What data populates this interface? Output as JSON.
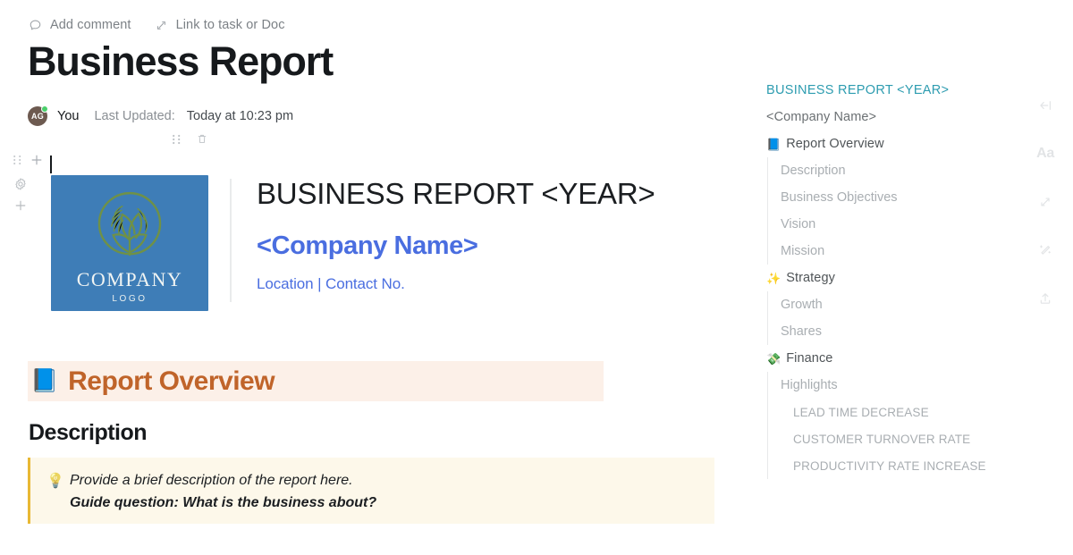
{
  "topbar": {
    "add_comment": "Add comment",
    "link_to_task": "Link to task or Doc",
    "comment_icon": "comment-bubble-icon",
    "link_icon": "link-arrow-icon"
  },
  "document": {
    "title": "Business Report",
    "author_initials": "AG",
    "author_label": "You",
    "last_updated_label": "Last Updated:",
    "last_updated_value": "Today at 10:23 pm",
    "presence": "online"
  },
  "block_controls": {
    "drag_handle": "drag-handle-icon",
    "delete": "trash-icon",
    "add": "plus-icon",
    "settings": "gear-icon"
  },
  "hero": {
    "logo": {
      "company_text": "COMPANY",
      "sub_text": "LOGO",
      "background_color": "#3E7DB7",
      "emblem_color": "#6B8E42",
      "emblem_name": "leaf-circle-emblem"
    },
    "heading": "BUSINESS REPORT <YEAR>",
    "company_name": "<Company Name>",
    "contact_line": "Location | Contact No.",
    "accent_color": "#4A6EE0"
  },
  "section": {
    "emoji": "📘",
    "emoji_name": "blue-book-emoji",
    "title": "Report Overview",
    "title_color": "#C0642A",
    "highlight_color": "#FCF0E8"
  },
  "description": {
    "heading": "Description",
    "callout": {
      "emoji": "💡",
      "emoji_name": "lightbulb-emoji",
      "line1": "Provide a brief description of the report here.",
      "line2": "Guide question: What is the business about?",
      "background_color": "#FDF8EA",
      "border_color": "#E8B834"
    }
  },
  "outline": {
    "items": [
      {
        "label": "BUSINESS REPORT <YEAR>",
        "level": 0,
        "active": true,
        "emoji": ""
      },
      {
        "label": "<Company Name>",
        "level": 0,
        "active": false,
        "emoji": ""
      },
      {
        "label": "Report Overview",
        "level": 0,
        "active": false,
        "emoji": "📘"
      },
      {
        "label": "Description",
        "level": 1,
        "active": false,
        "emoji": ""
      },
      {
        "label": "Business Objectives",
        "level": 1,
        "active": false,
        "emoji": ""
      },
      {
        "label": "Vision",
        "level": 1,
        "active": false,
        "emoji": ""
      },
      {
        "label": "Mission",
        "level": 1,
        "active": false,
        "emoji": ""
      },
      {
        "label": "Strategy",
        "level": 0,
        "active": false,
        "emoji": "✨"
      },
      {
        "label": "Growth",
        "level": 1,
        "active": false,
        "emoji": ""
      },
      {
        "label": "Shares",
        "level": 1,
        "active": false,
        "emoji": ""
      },
      {
        "label": "Finance",
        "level": 0,
        "active": false,
        "emoji": "💸"
      },
      {
        "label": "Highlights",
        "level": 1,
        "active": false,
        "emoji": ""
      },
      {
        "label": "LEAD TIME DECREASE",
        "level": 2,
        "active": false,
        "emoji": ""
      },
      {
        "label": "CUSTOMER TURNOVER RATE",
        "level": 2,
        "active": false,
        "emoji": ""
      },
      {
        "label": "PRODUCTIVITY RATE INCREASE",
        "level": 2,
        "active": false,
        "emoji": ""
      }
    ],
    "active_color": "#2D9CB0"
  },
  "rail": {
    "collapse_label": "collapse-panel-icon",
    "font_label": "Aa",
    "relationships_label": "relationships-icon",
    "ai_label": "magic-wand-icon",
    "share_label": "share-upload-icon"
  }
}
